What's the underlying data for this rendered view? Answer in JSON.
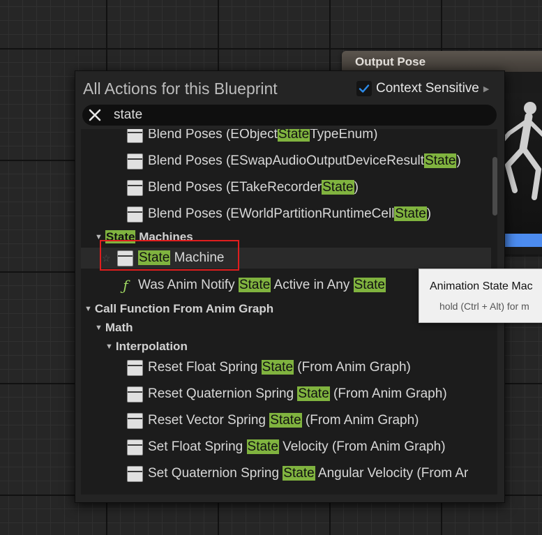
{
  "output_node": {
    "title": "Output Pose"
  },
  "menu": {
    "title": "All Actions for this Blueprint",
    "context_sensitive": {
      "label": "Context Sensitive",
      "checked": true
    },
    "search": {
      "value": "state",
      "clear_icon": "close-icon"
    }
  },
  "results": {
    "rows": [
      {
        "kind": "item",
        "icon": "node-icon",
        "parts": [
          "Blend Poses (EObject",
          "State",
          "TypeEnum)"
        ]
      },
      {
        "kind": "item",
        "icon": "node-icon",
        "parts": [
          "Blend Poses (ESwapAudioOutputDeviceResult",
          "State",
          ")"
        ]
      },
      {
        "kind": "item",
        "icon": "node-icon",
        "parts": [
          "Blend Poses (ETakeRecorder",
          "State",
          ")"
        ]
      },
      {
        "kind": "item",
        "icon": "node-icon",
        "parts": [
          "Blend Poses (EWorldPartitionRuntimeCell",
          "State",
          ")"
        ]
      },
      {
        "kind": "category",
        "parts": [
          "",
          "State",
          " Machines"
        ]
      },
      {
        "kind": "item",
        "icon": "node-icon",
        "favorite": true,
        "selected": true,
        "parts": [
          "",
          "State",
          " Machine"
        ]
      },
      {
        "kind": "item",
        "icon": "function-icon",
        "parts": [
          "Was Anim Notify ",
          "State",
          " Active in Any ",
          "State",
          ""
        ]
      },
      {
        "kind": "category",
        "parts": [
          "Call Function From Anim Graph"
        ]
      },
      {
        "kind": "category",
        "parts": [
          "Math"
        ]
      },
      {
        "kind": "category",
        "parts": [
          "Interpolation"
        ]
      },
      {
        "kind": "item",
        "icon": "node-icon",
        "parts": [
          "Reset Float Spring ",
          "State",
          " (From Anim Graph)"
        ]
      },
      {
        "kind": "item",
        "icon": "node-icon",
        "parts": [
          "Reset Quaternion Spring ",
          "State",
          " (From Anim Graph)"
        ]
      },
      {
        "kind": "item",
        "icon": "node-icon",
        "parts": [
          "Reset Vector Spring ",
          "State",
          " (From Anim Graph)"
        ]
      },
      {
        "kind": "item",
        "icon": "node-icon",
        "parts": [
          "Set Float Spring ",
          "State",
          " Velocity (From Anim Graph)"
        ]
      },
      {
        "kind": "item",
        "icon": "node-icon",
        "parts": [
          "Set Quaternion Spring ",
          "State",
          " Angular Velocity (From Ar"
        ]
      }
    ]
  },
  "tooltip": {
    "title": "Animation State Mac",
    "hint": "hold (Ctrl + Alt) for m"
  },
  "colors": {
    "highlight": "#80b33f",
    "selection_box": "#e01e1e",
    "accent": "#2d8ceb"
  }
}
